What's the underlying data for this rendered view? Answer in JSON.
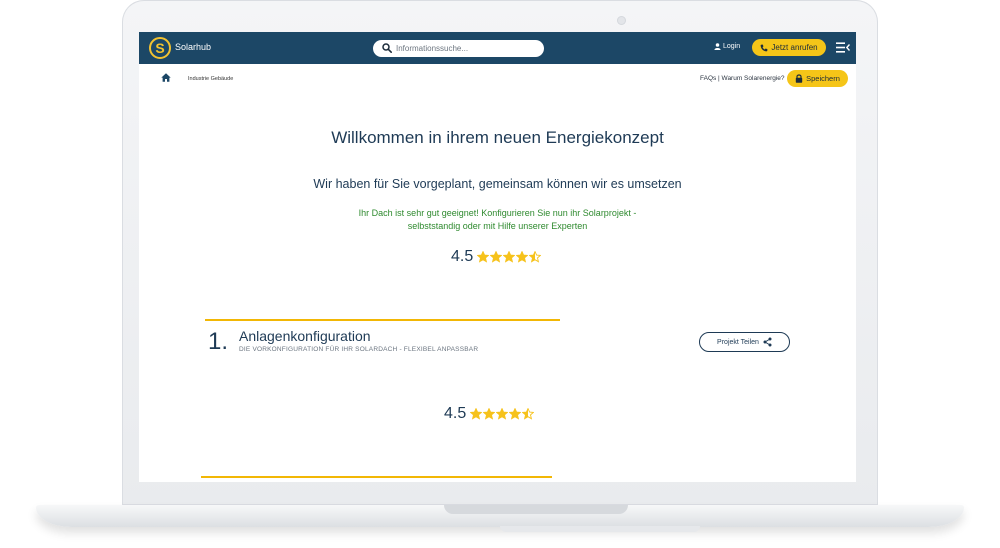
{
  "colors": {
    "brand_navy": "#1c4766",
    "accent_yellow": "#f5c518",
    "headline": "#1e3a55",
    "success_green": "#2f8a2f",
    "star": "#f6c21b"
  },
  "header": {
    "logo_letter": "S",
    "logo_text": "Solarhub",
    "search_placeholder": "Informationssuche...",
    "login_label": "Login",
    "call_label": "Jetzt anrufen",
    "icons": [
      "search-icon",
      "user-icon",
      "phone-icon",
      "menu-icon"
    ]
  },
  "subbar": {
    "breadcrumb": "Industrie Gebäude",
    "faq_link": "FAQs | Warum Solarenergie?",
    "save_label": "Speichern",
    "icons": [
      "home-icon",
      "lock-icon"
    ]
  },
  "hero": {
    "title": "Willkommen in ihrem neuen Energiekonzept",
    "subtitle": "Wir haben für Sie vorgeplant, gemeinsam können wir es umsetzen",
    "note_line1": "Ihr Dach ist sehr gut geeignet! Konfigurieren Sie nun ihr Solarprojekt -",
    "note_line2": "selbststandig oder mit Hilfe unserer Experten",
    "rating": "4.5",
    "rating_value": 4.5
  },
  "section1": {
    "number": "1.",
    "title": "Anlagenkonfiguration",
    "subtitle": "DIE VORKONFIGURATION FÜR IHR SOLARDACH - FLEXIBEL ANPASSBAR",
    "share_label": "Projekt Teilen",
    "rating": "4.5",
    "rating_value": 4.5
  }
}
